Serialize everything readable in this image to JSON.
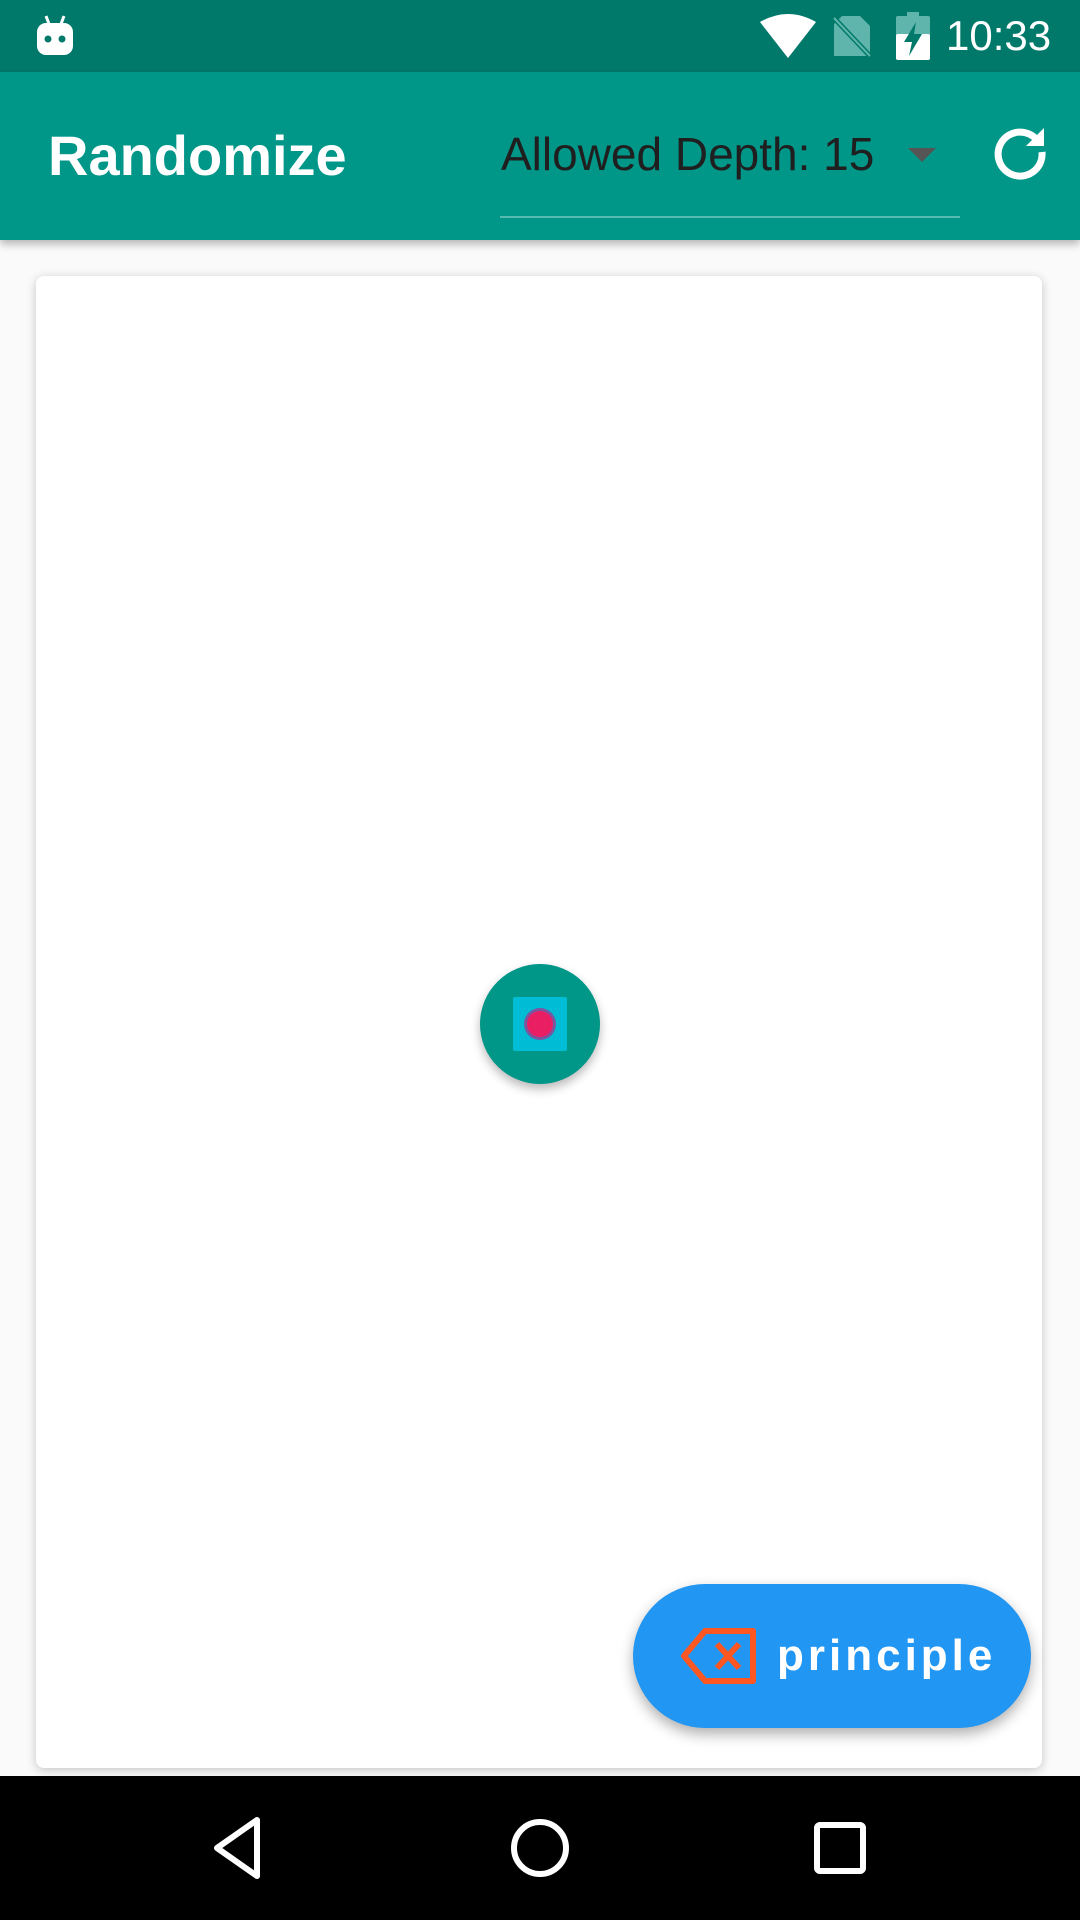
{
  "status_bar": {
    "time": "10:33",
    "icons": [
      "android-robot-icon",
      "wifi-icon",
      "no-sim-icon",
      "battery-charging-icon"
    ]
  },
  "app_bar": {
    "title": "Randomize",
    "depth_select": {
      "value": "Allowed Depth: 15",
      "icon": "dropdown-caret-icon"
    },
    "refresh_icon": "refresh-icon"
  },
  "canvas": {
    "node": {
      "outer_color": "#009688",
      "inner_color": "#00bcd4",
      "dot_color": "#e91e63"
    }
  },
  "fab": {
    "label": "principle",
    "icon": "backspace-icon",
    "icon_color": "#ff5722",
    "background": "#2196f3"
  },
  "nav_bar": {
    "icons": [
      "back-triangle-icon",
      "home-circle-icon",
      "recents-square-icon"
    ]
  },
  "colors": {
    "status_bar": "#00796b",
    "primary": "#009688",
    "accent": "#2196f3"
  }
}
